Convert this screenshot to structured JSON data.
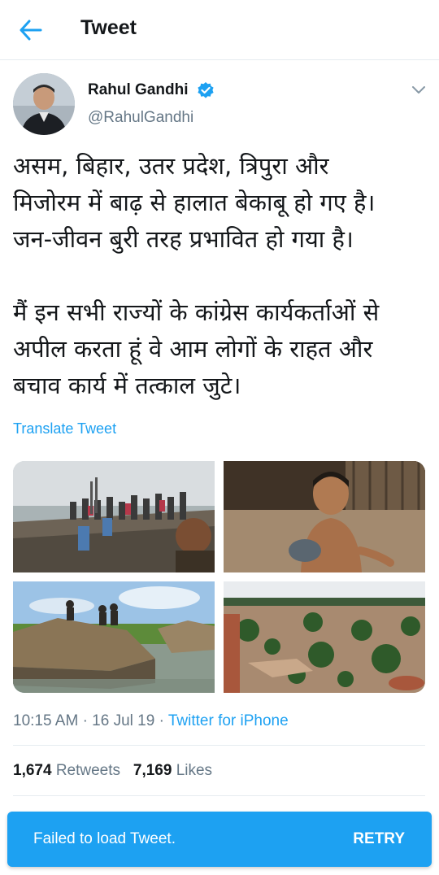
{
  "header": {
    "title": "Tweet",
    "back_icon": "arrow-left-icon"
  },
  "author": {
    "name": "Rahul Gandhi",
    "handle": "@RahulGandhi",
    "verified": true,
    "verified_color": "#1da1f2"
  },
  "tweet": {
    "lines": [
      "असम, बिहार, उतर प्रदेश, त्रिपुरा और",
      "मिजोरम में बाढ़ से हालात बेकाबू हो गए है।",
      "जन-जीवन बुरी तरह प्रभावित हो गया है।",
      "",
      "मैं इन सभी राज्यों के कांग्रेस कार्यकर्ताओं से",
      "अपील करता हूं वे आम लोगों के राहत और",
      "बचाव कार्य में तत्काल जुटे।"
    ],
    "translate_label": "Translate Tweet"
  },
  "media": {
    "photo_count": 4,
    "photo_descriptions": [
      "flood-victims-on-embankment",
      "child-in-floodwater",
      "people-on-submerged-hut-roof",
      "flooded-village-aerial"
    ]
  },
  "meta": {
    "time": "10:15 AM",
    "separator": "·",
    "date": "16 Jul 19",
    "source": "Twitter for iPhone"
  },
  "stats": {
    "retweets_count": "1,674",
    "retweets_label": "Retweets",
    "likes_count": "7,169",
    "likes_label": "Likes"
  },
  "snackbar": {
    "message": "Failed to load Tweet.",
    "action": "RETRY",
    "color": "#1da1f2"
  },
  "colors": {
    "accent": "#1da1f2",
    "text": "#14171a",
    "secondary": "#657786",
    "divider": "#e6ecf0"
  }
}
